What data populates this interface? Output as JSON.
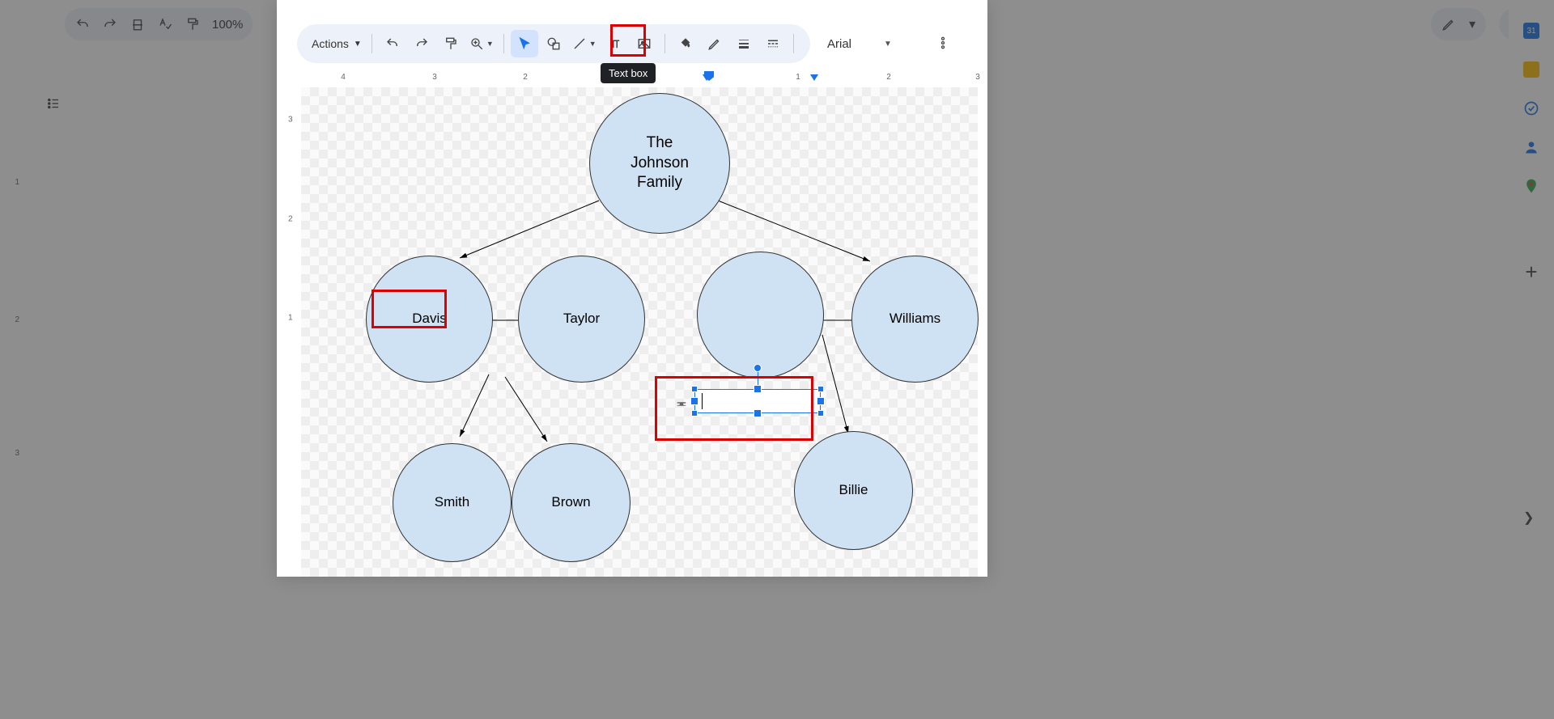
{
  "bg": {
    "zoom": "100%"
  },
  "drawing": {
    "actions_label": "Actions",
    "font": "Arial",
    "tooltip": "Text box",
    "h_ruler_labels": [
      "4",
      "3",
      "2",
      "1",
      "1",
      "2",
      "3"
    ],
    "v_ruler_labels": [
      "3",
      "2",
      "1"
    ],
    "textbox_value": ""
  },
  "diagram": {
    "root": "The\nJohnson\nFamily",
    "level2": {
      "davis": "Davis",
      "taylor": "Taylor",
      "blank": "",
      "williams": "Williams"
    },
    "level3": {
      "smith": "Smith",
      "brown": "Brown",
      "billie": "Billie"
    }
  }
}
